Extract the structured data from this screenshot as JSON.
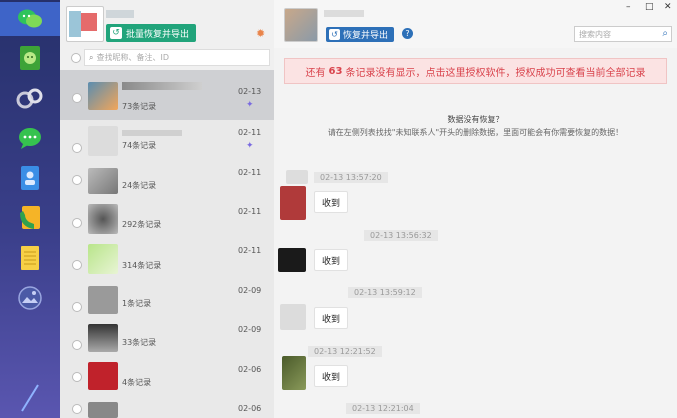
{
  "sidebar": {
    "icons": [
      "wechat-icon",
      "assistant-icon",
      "moments-icon",
      "chat-icon",
      "contacts-icon",
      "call-icon",
      "notes-icon",
      "gallery-icon",
      "pen-icon"
    ],
    "accent": "#3e64c8"
  },
  "list": {
    "batch_button": "批量恢复并导出",
    "search_placeholder": "查找昵称、备注、ID",
    "contacts": [
      {
        "count": "73条记录",
        "date": "02-13",
        "selected": true
      },
      {
        "count": "74条记录",
        "date": "02-11",
        "selected": false
      },
      {
        "count": "24条记录",
        "date": "02-11",
        "selected": false
      },
      {
        "count": "292条记录",
        "date": "02-11",
        "selected": false
      },
      {
        "count": "314条记录",
        "date": "02-11",
        "selected": false
      },
      {
        "count": "1条记录",
        "date": "02-09",
        "selected": false
      },
      {
        "count": "33条记录",
        "date": "02-09",
        "selected": false
      },
      {
        "count": "4条记录",
        "date": "02-06",
        "selected": false
      },
      {
        "count": "",
        "date": "02-06",
        "selected": false
      }
    ]
  },
  "main": {
    "restore_button": "恢复并导出",
    "help_label": "?",
    "search_placeholder": "搜索内容",
    "window": {
      "min": "–",
      "max": "□",
      "close": "✕"
    },
    "banner": {
      "pre": "还有",
      "count": "63",
      "post": "条记录没有显示，点击这里授权软件，授权成功可查看当前全部记录"
    },
    "notice_title": "数据没有恢复？",
    "notice_body": "请在左侧列表找找\"未知联系人\"开头的删除数据，里面可能会有你需要恢复的数据！",
    "messages": [
      {
        "time": "02-13 13:57:20",
        "text": "收到"
      },
      {
        "time": "02-13 13:56:32",
        "text": "收到"
      },
      {
        "time": "02-13 13:59:12",
        "text": "收到"
      },
      {
        "time": "02-13 12:21:52",
        "text": "收到"
      },
      {
        "time": "02-13 12:21:04",
        "text": ""
      }
    ]
  }
}
